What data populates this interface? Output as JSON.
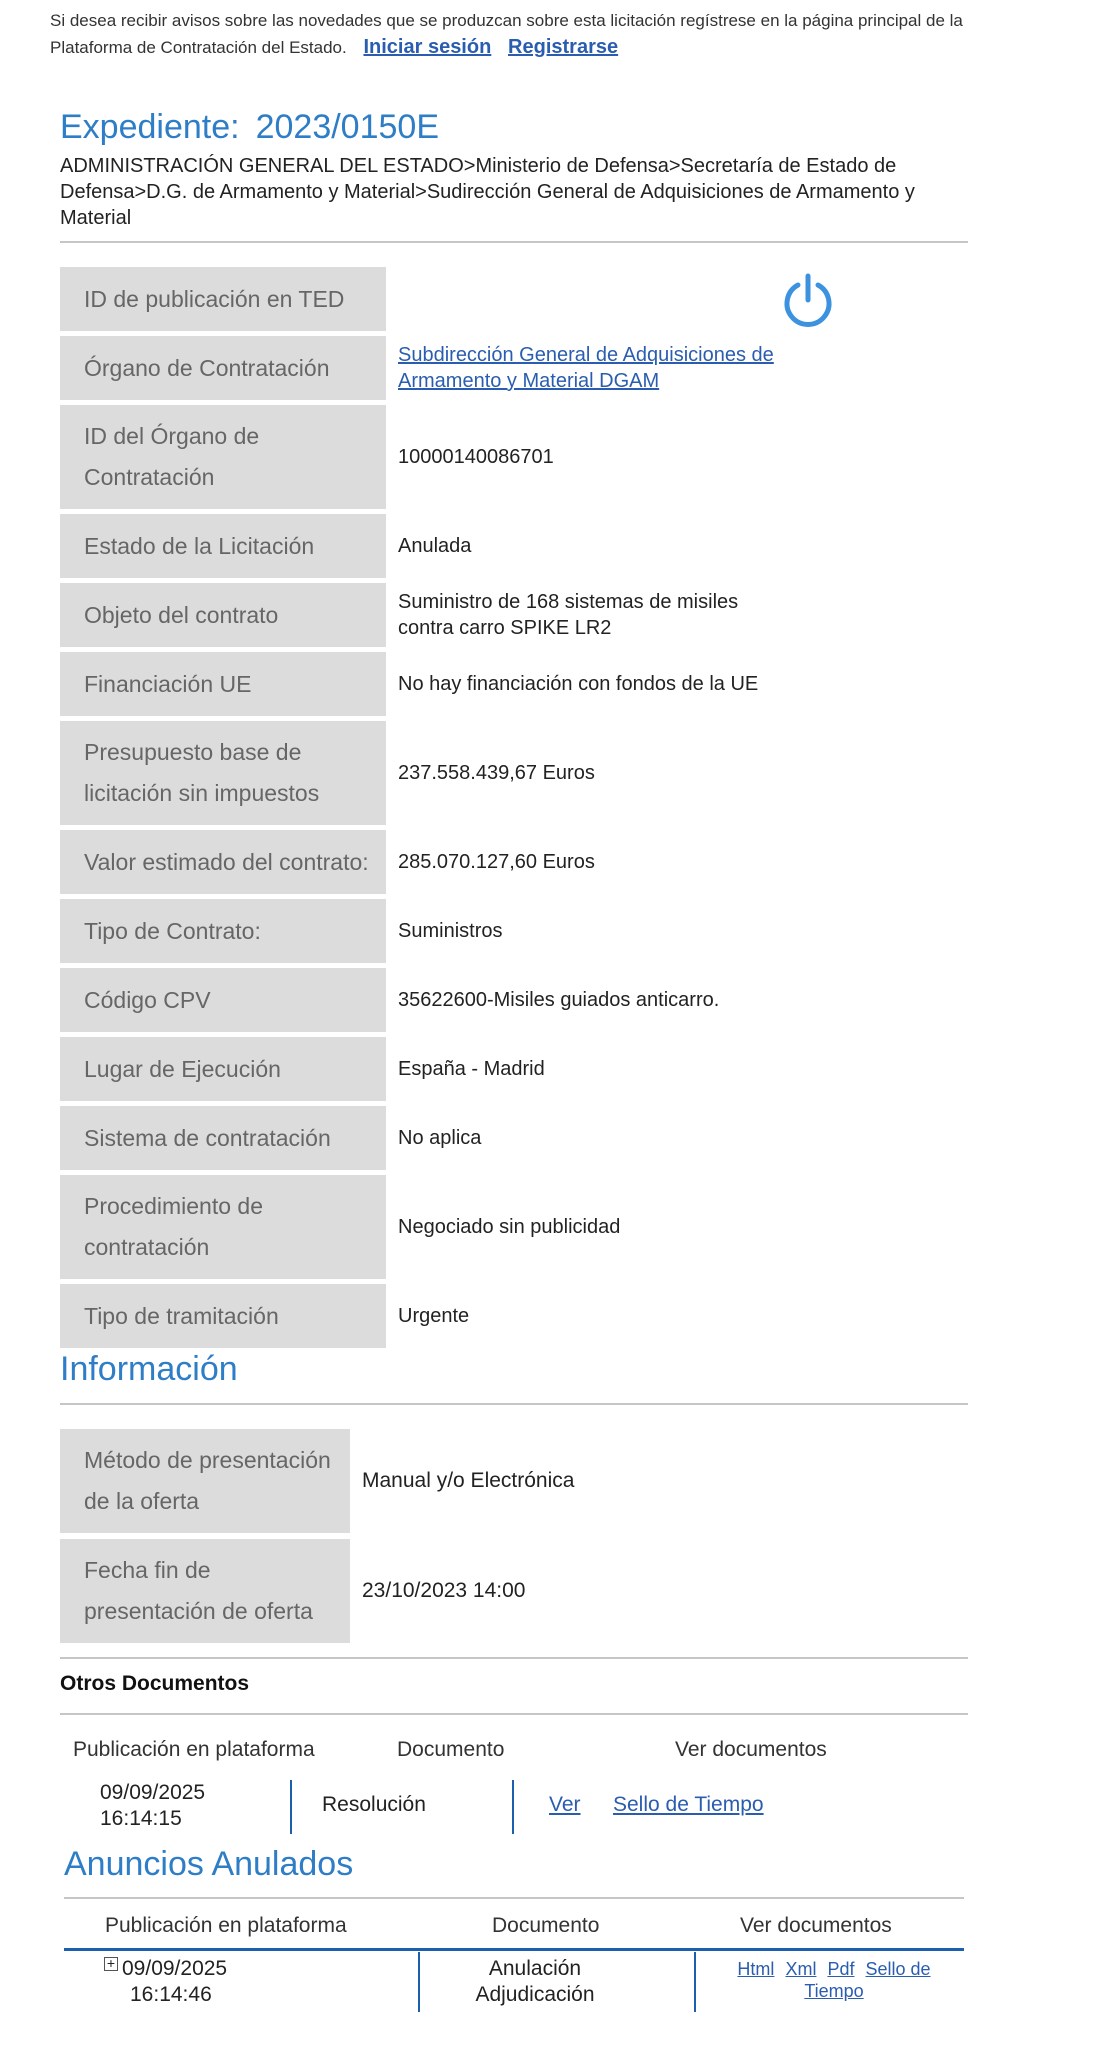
{
  "notice": {
    "text": "Si desea recibir avisos sobre las novedades que se produzcan sobre esta licitación regístrese en la página principal de la Plataforma de Contratación del Estado.",
    "login_label": "Iniciar sesión",
    "register_label": "Registrarse"
  },
  "header": {
    "title_label": "Expediente:",
    "expediente": "2023/0150E",
    "breadcrumb": "ADMINISTRACIÓN GENERAL DEL ESTADO>Ministerio de Defensa>Secretaría de Estado de Defensa>D.G. de Armamento y Material>Sudirección General de Adquisiciones de Armamento y Material"
  },
  "details": [
    {
      "label": "ID de publicación en TED",
      "value": ""
    },
    {
      "label": "Órgano de Contratación",
      "value": "Subdirección General de Adquisiciones de Armamento y Material DGAM"
    },
    {
      "label": "ID del Órgano de Contratación",
      "value": "10000140086701"
    },
    {
      "label": "Estado de la Licitación",
      "value": "Anulada"
    },
    {
      "label": "Objeto del contrato",
      "value": "Suministro de 168 sistemas de misiles contra carro SPIKE LR2"
    },
    {
      "label": "Financiación UE",
      "value": "No hay financiación con fondos de la UE"
    },
    {
      "label": "Presupuesto base de licitación sin impuestos",
      "value": "237.558.439,67 Euros"
    },
    {
      "label": "Valor estimado del contrato:",
      "value": "285.070.127,60 Euros"
    },
    {
      "label": "Tipo de Contrato:",
      "value": "Suministros"
    },
    {
      "label": "Código CPV",
      "value": "35622600-Misiles guiados anticarro."
    },
    {
      "label": "Lugar de Ejecución",
      "value": "España - Madrid"
    },
    {
      "label": "Sistema de contratación",
      "value": "No aplica"
    },
    {
      "label": "Procedimiento de contratación",
      "value": "Negociado sin publicidad"
    },
    {
      "label": "Tipo de tramitación",
      "value": "Urgente"
    }
  ],
  "informacion": {
    "title": "Información",
    "rows": [
      {
        "label": "Método de presentación de la oferta",
        "value": "Manual y/o Electrónica"
      },
      {
        "label": "Fecha fin de presentación de oferta",
        "value": "23/10/2023 14:00"
      }
    ]
  },
  "otros_documentos": {
    "title": "Otros Documentos",
    "headers": [
      "Publicación en plataforma",
      "Documento",
      "Ver documentos"
    ],
    "rows": [
      {
        "date": "09/09/2025",
        "time": "16:14:15",
        "document": "Resolución",
        "links": [
          "Ver",
          "Sello de Tiempo"
        ]
      }
    ]
  },
  "anuncios_anulados": {
    "title": "Anuncios Anulados",
    "headers": [
      "Publicación en plataforma",
      "Documento",
      "Ver documentos"
    ],
    "rows": [
      {
        "date": "09/09/2025",
        "time": "16:14:46",
        "document_line1": "Anulación",
        "document_line2": "Adjudicación",
        "links": [
          "Html",
          "Xml",
          "Pdf",
          "Sello de Tiempo"
        ]
      }
    ]
  }
}
